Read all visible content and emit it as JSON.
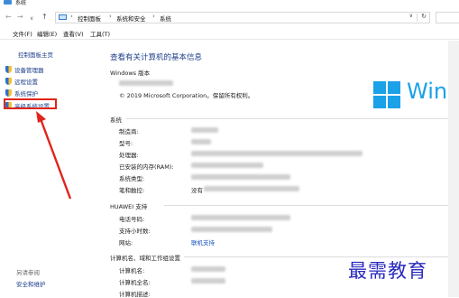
{
  "window": {
    "title": "系统"
  },
  "nav": {
    "back": "←",
    "forward": "→",
    "recent": "∨",
    "up": "↑"
  },
  "address": {
    "crumbs": [
      "控制面板",
      "系统和安全",
      "系统"
    ],
    "separator": "›",
    "dropdown": "∨",
    "refresh": "↻"
  },
  "menu": [
    "文件(F)",
    "编辑(E)",
    "查看(V)",
    "工具(T)"
  ],
  "sidebar": {
    "home": "控制面板主页",
    "items": [
      {
        "label": "设备管理器",
        "icon": "shield-icon"
      },
      {
        "label": "远程设置",
        "icon": "shield-icon"
      },
      {
        "label": "系统保护",
        "icon": "shield-icon"
      },
      {
        "label": "高级系统设置",
        "icon": "shield-icon"
      }
    ],
    "see_also": "另请参阅",
    "security_link": "安全和维护"
  },
  "main": {
    "title": "查看有关计算机的基本信息",
    "windows_edition": {
      "heading": "Windows 版本",
      "copyright": "© 2019 Microsoft Corporation。保留所有权利。",
      "logo_text": "Win"
    },
    "system": {
      "heading": "系统",
      "rows": [
        "制造商:",
        "型号:",
        "处理器:",
        "已安装的内存(RAM):",
        "系统类型:",
        "笔和触控:"
      ],
      "pen_value_prefix": "没有"
    },
    "support": {
      "heading": "HUAWEI 支持",
      "rows": [
        "电话号码:",
        "支持小时数:",
        "网站:"
      ],
      "website_link": "联机支持"
    },
    "computer": {
      "heading": "计算机名、域和工作组设置",
      "rows": [
        "计算机名:",
        "计算机全名:",
        "计算机描述:"
      ]
    }
  },
  "watermark": "最需教育",
  "colors": {
    "link": "#1a3d8a",
    "accent": "#1ba1e8",
    "highlight": "#e0241b"
  }
}
